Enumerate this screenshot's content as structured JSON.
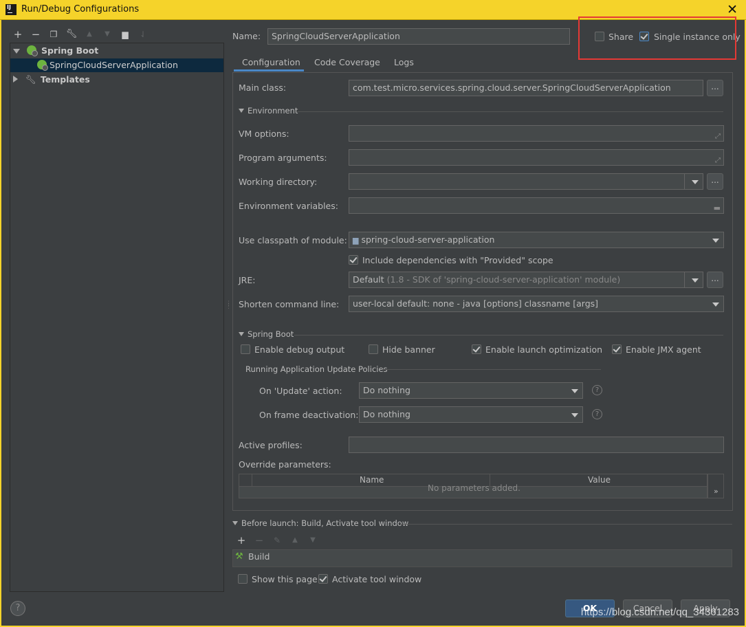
{
  "window": {
    "title": "Run/Debug Configurations",
    "app_icon": "intellij-icon",
    "close_icon": "close-icon"
  },
  "toolbar": {
    "icons": [
      "add-icon",
      "remove-icon",
      "copy-icon",
      "wrench-icon",
      "move-up-icon",
      "move-down-icon",
      "folder-icon",
      "sort-icon"
    ]
  },
  "tree": {
    "group": "Spring Boot",
    "item": "SpringCloudServerApplication",
    "templates": "Templates"
  },
  "name_field": {
    "label": "Name:",
    "value": "SpringCloudServerApplication"
  },
  "share": {
    "label": "Share",
    "checked": false
  },
  "single_instance": {
    "label": "Single instance only",
    "checked": true
  },
  "tabs": [
    {
      "label": "Configuration",
      "active": true
    },
    {
      "label": "Code Coverage",
      "active": false
    },
    {
      "label": "Logs",
      "active": false
    }
  ],
  "config": {
    "main_class_label": "Main class:",
    "main_class_value": "com.test.micro.services.spring.cloud.server.SpringCloudServerApplication",
    "browse_label": "...",
    "environment_section": "Environment",
    "vm_options_label": "VM options:",
    "program_args_label": "Program arguments:",
    "working_dir_label": "Working directory:",
    "env_vars_label": "Environment variables:",
    "classpath_label": "Use classpath of module:",
    "classpath_value": "spring-cloud-server-application",
    "include_deps_label": "Include dependencies with \"Provided\" scope",
    "include_deps_checked": true,
    "jre_label": "JRE:",
    "jre_value": "Default",
    "jre_detail": "(1.8 - SDK of 'spring-cloud-server-application' module)",
    "shorten_label": "Shorten command line:",
    "shorten_value": "user-local default: none - java [options] classname [args]",
    "spring_boot_section": "Spring Boot",
    "enable_debug_label": "Enable debug output",
    "enable_debug_checked": false,
    "hide_banner_label": "Hide banner",
    "hide_banner_checked": false,
    "launch_opt_label": "Enable launch optimization",
    "launch_opt_checked": true,
    "jmx_label": "Enable JMX agent",
    "jmx_checked": true,
    "update_policies_label": "Running Application Update Policies",
    "on_update_label": "On 'Update' action:",
    "on_update_value": "Do nothing",
    "on_frame_label": "On frame deactivation:",
    "on_frame_value": "Do nothing",
    "help_glyph": "?",
    "active_profiles_label": "Active profiles:",
    "override_label": "Override parameters:",
    "table_headers": [
      "Name",
      "Value"
    ],
    "table_empty": "No parameters added.",
    "expand_glyph": "»"
  },
  "before_launch": {
    "label": "Before launch: Build, Activate tool window",
    "task": "Build",
    "show_page_label": "Show this page",
    "show_page_checked": false,
    "activate_label": "Activate tool window",
    "activate_checked": true
  },
  "buttons": {
    "ok": "OK",
    "cancel": "Cancel",
    "apply": "Apply",
    "help": "?"
  },
  "watermark": "https://blog.csdn.net/qq_34361283",
  "colors": {
    "titlebar": "#f5d32a",
    "background": "#3c3f41",
    "selection": "#0d293e",
    "highlight_box": "#e53935",
    "ok_button": "#365880"
  }
}
